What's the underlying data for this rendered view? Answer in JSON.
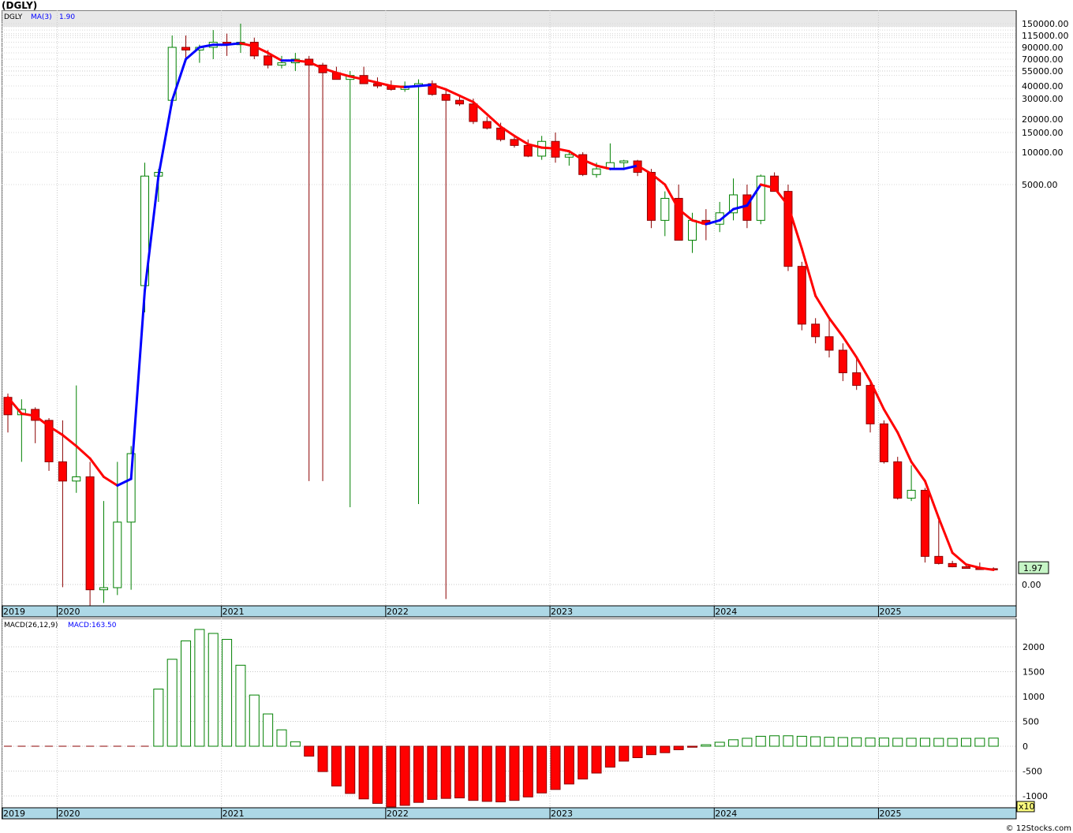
{
  "symbol": "(DGLY)",
  "copyright": "© 12Stocks.com",
  "price_panel": {
    "ticker_label": "DGLY",
    "ma_label": "MA(3)",
    "ma_value": "1.90",
    "last_price": "1.97",
    "y_ticks": [
      "150000.00",
      "115000.00",
      "90000.00",
      "70000.00",
      "55000.00",
      "40000.00",
      "30000.00",
      "20000.00",
      "15000.00",
      "10000.00",
      "5000.00",
      "0.00"
    ],
    "year_labels": [
      "2019",
      "2020",
      "2021",
      "2022",
      "2023",
      "2024",
      "2025"
    ]
  },
  "macd_panel": {
    "label": "MACD(26,12,9)",
    "value_label": "MACD:163.50",
    "multiplier": "x10",
    "y_ticks": [
      "2000",
      "1500",
      "1000",
      "500",
      "0",
      "-500",
      "-1000"
    ],
    "year_labels": [
      "2019",
      "2020",
      "2021",
      "2022",
      "2023",
      "2024",
      "2025"
    ]
  },
  "colors": {
    "up": "#008000",
    "down": "#ff0000",
    "ma_up": "#0000ff",
    "ma_down": "#ff0000",
    "axis_bar": "#add8e6",
    "last_price_bg": "#c6f5c6"
  },
  "chart_data": [
    {
      "type": "candlestick",
      "title": "(DGLY)",
      "scale": "log",
      "ylim": [
        0,
        150000
      ],
      "x": [
        "2019-10",
        "2019-11",
        "2019-12",
        "2020-01",
        "2020-02",
        "2020-03",
        "2020-04",
        "2020-05",
        "2020-06",
        "2020-07",
        "2020-08",
        "2020-09",
        "2020-10",
        "2020-11",
        "2020-12",
        "2021-01",
        "2021-02",
        "2021-03",
        "2021-04",
        "2021-05",
        "2021-06",
        "2021-07",
        "2021-08",
        "2021-09",
        "2021-10",
        "2021-11",
        "2021-12",
        "2022-01",
        "2022-02",
        "2022-03",
        "2022-04",
        "2022-05",
        "2022-06",
        "2022-07",
        "2022-08",
        "2022-09",
        "2022-10",
        "2022-11",
        "2022-12",
        "2023-01",
        "2023-02",
        "2023-03",
        "2023-04",
        "2023-05",
        "2023-06",
        "2023-07",
        "2023-08",
        "2023-09",
        "2023-10",
        "2023-11",
        "2023-12",
        "2024-01",
        "2024-02",
        "2024-03",
        "2024-04",
        "2024-05",
        "2024-06",
        "2024-07",
        "2024-08",
        "2024-09",
        "2024-10",
        "2024-11",
        "2024-12",
        "2025-01",
        "2025-02",
        "2025-03",
        "2025-04",
        "2025-05",
        "2025-06",
        "2025-07",
        "2025-08",
        "2025-09",
        "2025-10"
      ],
      "series": [
        {
          "name": "DGLY",
          "ohlc": [
            [
              820,
              860,
              500,
              650
            ],
            [
              650,
              800,
              300,
              700
            ],
            [
              700,
              720,
              420,
              600
            ],
            [
              600,
              620,
              250,
              300
            ],
            [
              300,
              600,
              -100,
              200
            ],
            [
              200,
              950,
              150,
              220
            ],
            [
              220,
              300,
              -800,
              -200
            ],
            [
              -200,
              120,
              -700,
              -120
            ],
            [
              -120,
              300,
              -400,
              60
            ],
            [
              60,
              400,
              -200,
              350
            ],
            [
              2500,
              8000,
              2000,
              6000
            ],
            [
              6000,
              7000,
              4500,
              6500
            ],
            [
              29000,
              115000,
              26000,
              90000
            ],
            [
              90000,
              115000,
              70000,
              85000
            ],
            [
              85000,
              95000,
              65000,
              90000
            ],
            [
              90000,
              130000,
              70000,
              100000
            ],
            [
              100000,
              120000,
              75000,
              95000
            ],
            [
              95000,
              150000,
              80000,
              100000
            ],
            [
              100000,
              110000,
              70000,
              75000
            ],
            [
              75000,
              85000,
              58000,
              62000
            ],
            [
              62000,
              75000,
              58000,
              65000
            ],
            [
              65000,
              80000,
              55000,
              70000
            ],
            [
              70000,
              75000,
              200,
              62000
            ],
            [
              62000,
              65000,
              200,
              53000
            ],
            [
              53000,
              60000,
              48000,
              46000
            ],
            [
              46000,
              55000,
              100,
              50000
            ],
            [
              50000,
              60000,
              42000,
              42000
            ],
            [
              42000,
              48000,
              38000,
              40000
            ],
            [
              40000,
              45000,
              36000,
              37000
            ],
            [
              37000,
              44000,
              35000,
              40000
            ],
            [
              40000,
              46000,
              110,
              42000
            ],
            [
              42000,
              45000,
              32000,
              33000
            ],
            [
              33000,
              37000,
              -550,
              29000
            ],
            [
              29000,
              32000,
              26000,
              27000
            ],
            [
              27000,
              30000,
              18000,
              19000
            ],
            [
              19000,
              21000,
              16000,
              16500
            ],
            [
              16500,
              18500,
              12500,
              13000
            ],
            [
              13000,
              14000,
              11000,
              11500
            ],
            [
              11500,
              13000,
              9000,
              9200
            ],
            [
              9200,
              14000,
              8500,
              12500
            ],
            [
              12500,
              15000,
              8000,
              9000
            ],
            [
              9000,
              10000,
              7500,
              9500
            ],
            [
              9500,
              10000,
              6000,
              6200
            ],
            [
              6200,
              8000,
              5800,
              7000
            ],
            [
              7000,
              12000,
              6800,
              8000
            ],
            [
              8000,
              8500,
              7200,
              8300
            ],
            [
              8300,
              8500,
              6000,
              6500
            ],
            [
              6500,
              7000,
              3800,
              4000
            ],
            [
              4000,
              4800,
              3600,
              4600
            ],
            [
              4600,
              5000,
              3500,
              3500
            ],
            [
              3500,
              4200,
              3200,
              4000
            ],
            [
              4000,
              4300,
              3500,
              3900
            ],
            [
              3900,
              4500,
              3700,
              4200
            ],
            [
              4200,
              5700,
              4000,
              4700
            ],
            [
              4700,
              5000,
              3800,
              4000
            ],
            [
              4000,
              6200,
              3900,
              6000
            ],
            [
              6000,
              6500,
              4800,
              4800
            ],
            [
              4800,
              5000,
              2800,
              2900
            ],
            [
              2900,
              3000,
              1700,
              1800
            ],
            [
              1800,
              1900,
              1500,
              1600
            ],
            [
              1600,
              1900,
              1300,
              1400
            ],
            [
              1400,
              1500,
              1000,
              1100
            ],
            [
              1100,
              1300,
              900,
              950
            ],
            [
              950,
              1000,
              500,
              570
            ],
            [
              570,
              600,
              290,
              300
            ],
            [
              300,
              330,
              125,
              130
            ],
            [
              130,
              280,
              120,
              160
            ],
            [
              160,
              170,
              5,
              9
            ],
            [
              9,
              70,
              4,
              4.5
            ],
            [
              4.5,
              6,
              2.8,
              3
            ],
            [
              3,
              3.4,
              2.3,
              2.4
            ],
            [
              2.4,
              5,
              2.1,
              2.3
            ],
            [
              2.3,
              2.8,
              1.9,
              1.97
            ]
          ]
        },
        {
          "name": "MA(3)",
          "values": [
            820,
            660,
            640,
            550,
            480,
            400,
            320,
            220,
            180,
            210,
            2400,
            6000,
            29000,
            70000,
            90000,
            95000,
            95000,
            98000,
            92000,
            80000,
            68000,
            68000,
            66000,
            58000,
            53000,
            49000,
            46000,
            43000,
            40000,
            39000,
            40000,
            41000,
            37000,
            32000,
            28000,
            22000,
            17000,
            14000,
            11800,
            11000,
            10800,
            10200,
            8500,
            7500,
            7000,
            7000,
            7500,
            6300,
            5000,
            4300,
            4000,
            3900,
            4000,
            4300,
            4400,
            5000,
            4900,
            4400,
            3300,
            2300,
            1900,
            1600,
            1300,
            1000,
            700,
            500,
            300,
            200,
            70,
            12,
            4,
            2.6,
            1.9
          ]
        }
      ]
    },
    {
      "type": "bar",
      "title": "MACD(26,12,9)",
      "ylim": [
        -1200,
        2400
      ],
      "x": [
        "2019-10",
        "2019-11",
        "2019-12",
        "2020-01",
        "2020-02",
        "2020-03",
        "2020-04",
        "2020-05",
        "2020-06",
        "2020-07",
        "2020-08",
        "2020-09",
        "2020-10",
        "2020-11",
        "2020-12",
        "2021-01",
        "2021-02",
        "2021-03",
        "2021-04",
        "2021-05",
        "2021-06",
        "2021-07",
        "2021-08",
        "2021-09",
        "2021-10",
        "2021-11",
        "2021-12",
        "2022-01",
        "2022-02",
        "2022-03",
        "2022-04",
        "2022-05",
        "2022-06",
        "2022-07",
        "2022-08",
        "2022-09",
        "2022-10",
        "2022-11",
        "2022-12",
        "2023-01",
        "2023-02",
        "2023-03",
        "2023-04",
        "2023-05",
        "2023-06",
        "2023-07",
        "2023-08",
        "2023-09",
        "2023-10",
        "2023-11",
        "2023-12",
        "2024-01",
        "2024-02",
        "2024-03",
        "2024-04",
        "2024-05",
        "2024-06",
        "2024-07",
        "2024-08",
        "2024-09",
        "2024-10",
        "2024-11",
        "2024-12",
        "2025-01",
        "2025-02",
        "2025-03",
        "2025-04",
        "2025-05",
        "2025-06",
        "2025-07",
        "2025-08",
        "2025-09",
        "2025-10"
      ],
      "values": [
        0,
        0,
        0,
        0,
        0,
        0,
        0,
        0,
        0,
        0,
        0,
        1150,
        1750,
        2120,
        2350,
        2270,
        2150,
        1630,
        1030,
        650,
        330,
        90,
        -200,
        -510,
        -800,
        -950,
        -1060,
        -1150,
        -1220,
        -1190,
        -1130,
        -1070,
        -1050,
        -1040,
        -1090,
        -1110,
        -1120,
        -1090,
        -1020,
        -940,
        -870,
        -760,
        -660,
        -540,
        -420,
        -300,
        -230,
        -170,
        -130,
        -70,
        -20,
        30,
        80,
        130,
        160,
        200,
        210,
        210,
        200,
        190,
        180,
        175,
        170,
        165,
        165,
        160,
        160,
        160,
        158,
        157,
        158,
        160,
        163.5
      ],
      "multiplier": "x10"
    }
  ]
}
